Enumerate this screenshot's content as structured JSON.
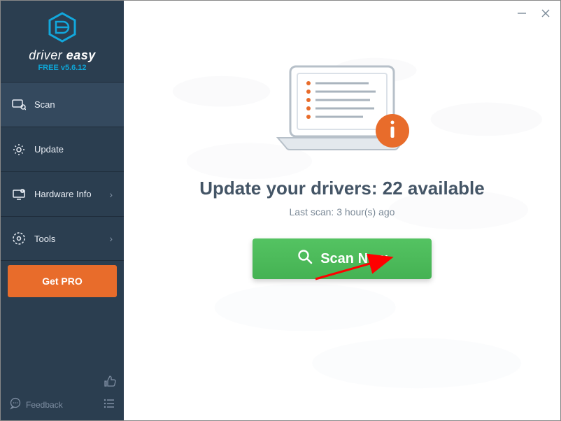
{
  "brand": {
    "name_part1": "driver",
    "name_part2": " easy",
    "version": "FREE v5.6.12"
  },
  "nav": {
    "scan": "Scan",
    "update": "Update",
    "hardware": "Hardware Info",
    "tools": "Tools"
  },
  "get_pro_label": "Get PRO",
  "feedback_label": "Feedback",
  "main": {
    "headline": "Update your drivers: 22 available",
    "last_scan": "Last scan: 3 hour(s) ago",
    "scan_button": "Scan Now"
  }
}
